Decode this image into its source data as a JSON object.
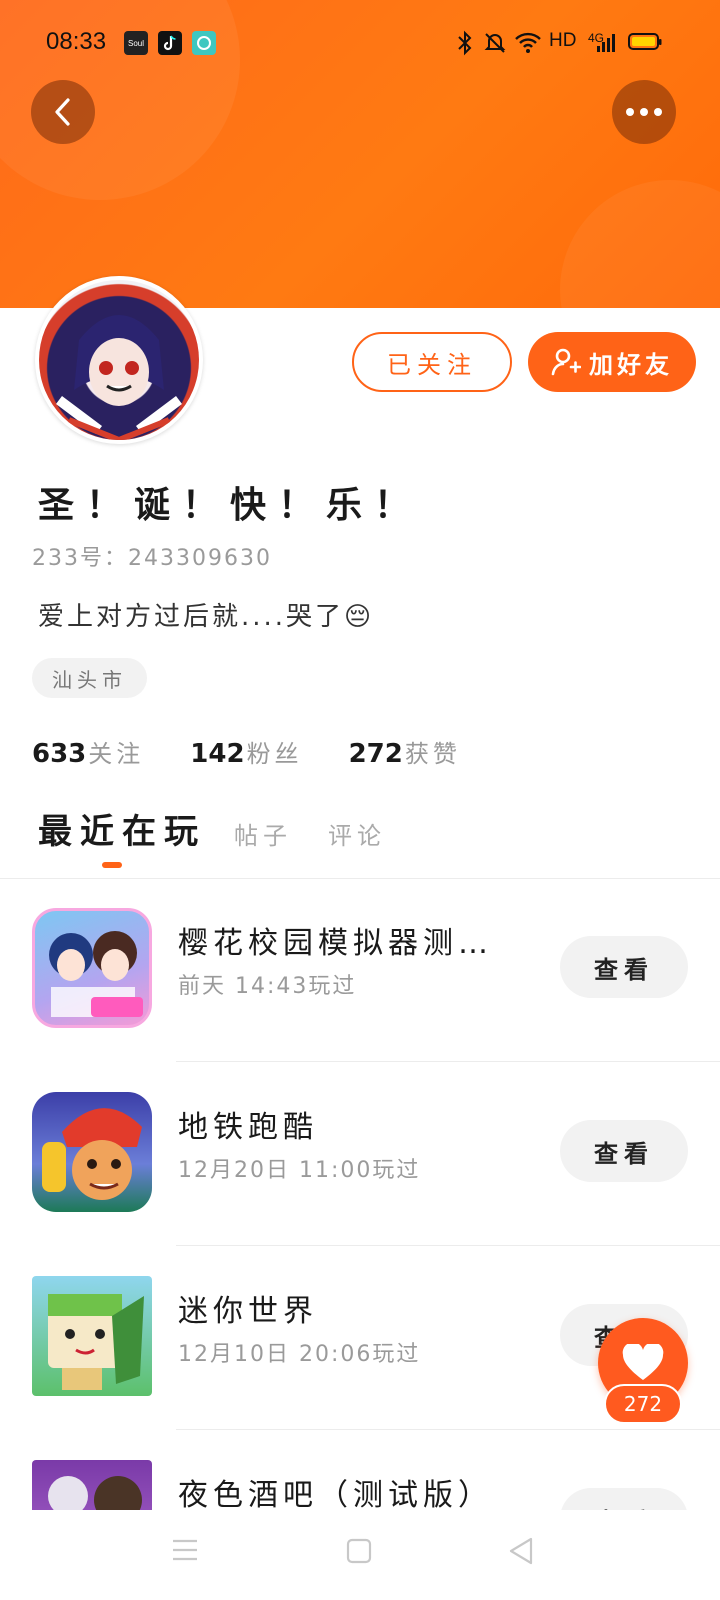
{
  "status_bar": {
    "time": "08:33",
    "network": "HD",
    "signal": "4G",
    "apps": [
      "soul-icon",
      "tiktok-icon",
      "app-icon"
    ]
  },
  "colors": {
    "accent": "#ff6317",
    "header": "#ff7a12"
  },
  "profile": {
    "nickname": "圣！诞！快！乐！",
    "id_label": "233号：",
    "id": "243309630",
    "bio": "爱上对方过后就....哭了😔",
    "location": "汕头市",
    "follow_button": "已关注",
    "add_friend_button": "加好友"
  },
  "stats": [
    {
      "value": "633",
      "label": "关注"
    },
    {
      "value": "142",
      "label": "粉丝"
    },
    {
      "value": "272",
      "label": "获赞"
    }
  ],
  "tabs": [
    {
      "label": "最近在玩",
      "active": true
    },
    {
      "label": "帖子",
      "active": false
    },
    {
      "label": "评论",
      "active": false
    }
  ],
  "games": [
    {
      "title": "樱花校园模拟器测…",
      "played": "前天 14:43玩过",
      "action": "查看"
    },
    {
      "title": "地铁跑酷",
      "played": "12月20日 11:00玩过",
      "action": "查看"
    },
    {
      "title": "迷你世界",
      "played": "12月10日 20:06玩过",
      "action": "查看"
    },
    {
      "title": "夜色酒吧（测试版）",
      "played": "",
      "action": "查看"
    }
  ],
  "like_fab": {
    "count": "272"
  }
}
